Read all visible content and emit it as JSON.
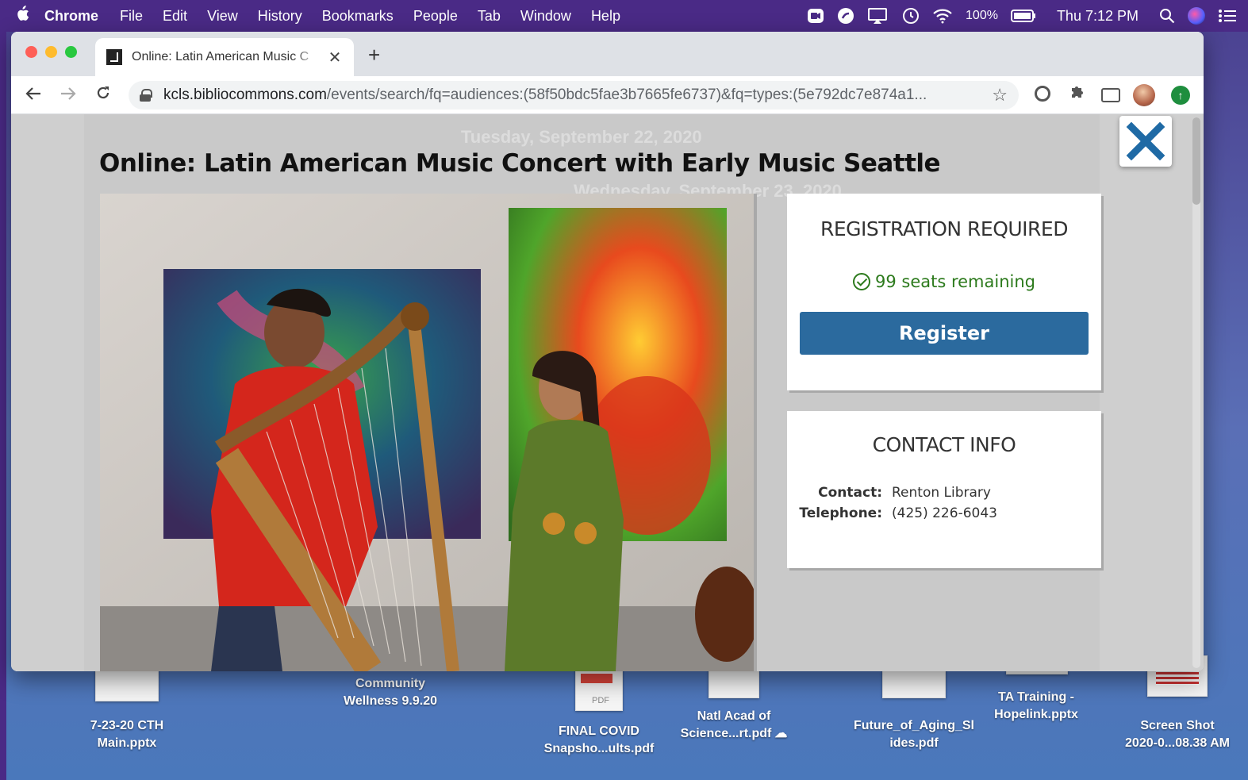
{
  "menubar": {
    "app_name": "Chrome",
    "items": [
      "File",
      "Edit",
      "View",
      "History",
      "Bookmarks",
      "People",
      "Tab",
      "Window",
      "Help"
    ],
    "battery": "100%",
    "clock": "Thu 7:12 PM",
    "status_icons": [
      "screen-record-icon",
      "creative-cloud-icon",
      "airplay-icon",
      "time-machine-icon",
      "wifi-icon",
      "battery-icon",
      "spotlight-search-icon",
      "siri-icon",
      "control-center-icon"
    ]
  },
  "browser": {
    "tab_title": "Online: Latin American Music C",
    "url_host": "kcls.bibliocommons.com",
    "url_path": "/events/search/fq=audiences:(58f50bdc5fae3b7665fe6737)&fq=types:(5e792dc7e874a1..."
  },
  "page": {
    "ghost_heading_1": "Tuesday, September 22, 2020",
    "ghost_heading_2": "Wednesday, September 23, 2020",
    "modal": {
      "title": "Online: Latin American Music Concert with Early Music Seattle",
      "photo_alt": "Two musicians performing with a harp and maracas",
      "registration": {
        "heading": "REGISTRATION REQUIRED",
        "seats": "99 seats remaining",
        "button": "Register"
      },
      "contact": {
        "heading": "CONTACT INFO",
        "rows": [
          {
            "key": "Contact:",
            "value": "Renton Library"
          },
          {
            "key": "Telephone:",
            "value": "(425) 226-6043"
          }
        ]
      }
    }
  },
  "desktop": {
    "icons": [
      {
        "line1": "7-23-20 CTH",
        "line2": "Main.pptx"
      },
      {
        "line1": "Community",
        "line2": "Wellness 9.9.20"
      },
      {
        "line1": "FINAL COVID",
        "line2": "Snapsho...ults.pdf"
      },
      {
        "line1": "Natl Acad of",
        "line2": "Science...rt.pdf"
      },
      {
        "line1": "Future_of_Aging_Sl",
        "line2": "ides.pdf"
      },
      {
        "line1": "TA Training -",
        "line2": "Hopelink.pptx"
      },
      {
        "line1": "Screen Shot",
        "line2": "2020-0...08.38 AM"
      }
    ]
  },
  "colors": {
    "register_button": "#2b6a9e",
    "seats_green": "#2c7a1c",
    "close_x": "#1f6aa5",
    "menubar": "#4a2a86"
  }
}
